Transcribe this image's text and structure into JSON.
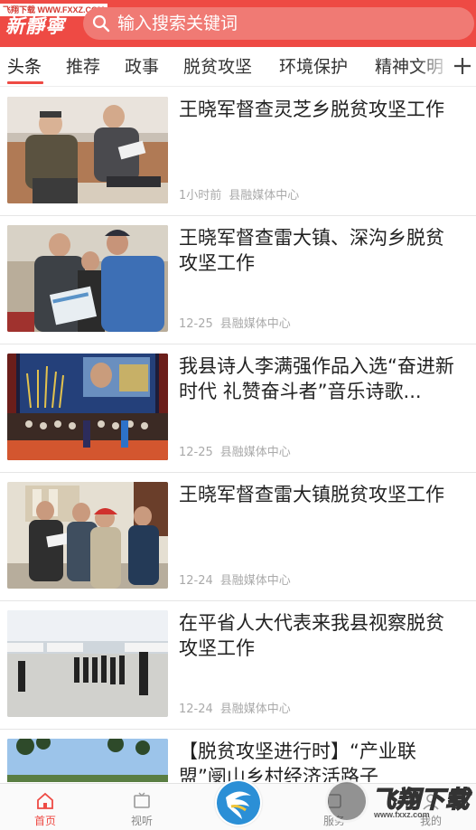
{
  "header": {
    "logo_text": "新靜寧",
    "watermark": "飞翔下载 WWW.FXXZ.COM",
    "search_placeholder": "输入搜索关键词"
  },
  "tabs": [
    {
      "label": "头条",
      "active": true
    },
    {
      "label": "推荐",
      "active": false
    },
    {
      "label": "政事",
      "active": false
    },
    {
      "label": "脱贫攻坚",
      "active": false
    },
    {
      "label": "环境保护",
      "active": false
    },
    {
      "label": "精神文明",
      "active": false
    }
  ],
  "feed": [
    {
      "title": "王晓军督查灵芝乡脱贫攻坚工作",
      "time": "1小时前",
      "source": "县融媒体中心",
      "image": "officials-in-office-photo"
    },
    {
      "title": "王晓军督查雷大镇、深沟乡脱贫攻坚工作",
      "time": "12-25",
      "source": "县融媒体中心",
      "image": "officials-reading-documents-photo"
    },
    {
      "title": "我县诗人李满强作品入选“奋进新时代 礼赞奋斗者”音乐诗歌...",
      "time": "12-25",
      "source": "县融媒体中心",
      "image": "stage-concert-photo"
    },
    {
      "title": "王晓军督查雷大镇脱贫攻坚工作",
      "time": "12-24",
      "source": "县融媒体中心",
      "image": "village-visit-photo"
    },
    {
      "title": "在平省人大代表来我县视察脱贫攻坚工作",
      "time": "12-24",
      "source": "县融媒体中心",
      "image": "greenhouse-inspection-photo"
    },
    {
      "title": "【脱贫攻坚进行时】“产业联盟”阌山乡村经济活路子",
      "time": "",
      "source": "",
      "image": "trees-sky-photo"
    }
  ],
  "bottom_nav": [
    {
      "label": "首页",
      "active": true,
      "icon": "home-icon"
    },
    {
      "label": "视听",
      "active": false,
      "icon": "tv-icon"
    },
    {
      "label": "",
      "active": false,
      "icon": "app-logo-icon"
    },
    {
      "label": "服务",
      "active": false,
      "icon": "service-icon"
    },
    {
      "label": "我的",
      "active": false,
      "icon": "user-icon"
    }
  ],
  "brand_watermark": {
    "title": "飞翔下载",
    "url": "www.fxxz.com"
  },
  "colors": {
    "accent": "#ee4a44",
    "text": "#222222",
    "meta": "#aaaaaa"
  }
}
